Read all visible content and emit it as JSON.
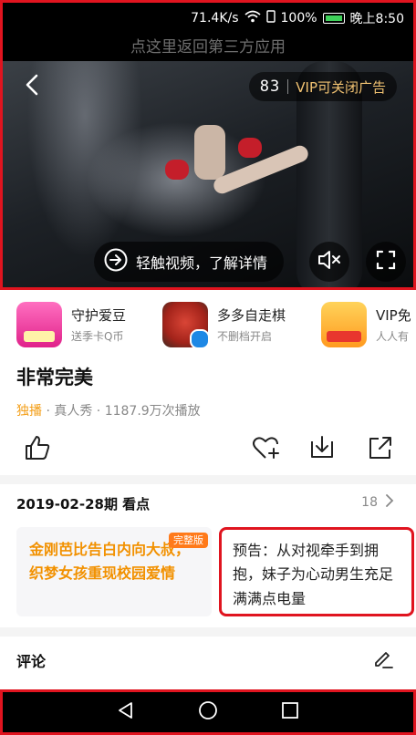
{
  "status": {
    "speed": "71.4K/s",
    "battery": "100%",
    "time": "晚上8:50"
  },
  "video": {
    "back_to_app": "点这里返回第三方应用",
    "countdown": "83",
    "vip_close_ad": "VIP可关闭广告",
    "tap_learn_more": "轻触视频，了解详情"
  },
  "ads": [
    {
      "title": "守护爱豆",
      "subtitle": "送季卡Q币"
    },
    {
      "title": "多多自走棋",
      "subtitle": "不删档开启"
    },
    {
      "title": "VIP免",
      "subtitle": "人人有"
    }
  ],
  "show": {
    "title": "非常完美",
    "exclusive": "独播",
    "meta_rest": " · 真人秀 · 1187.9万次播放"
  },
  "episodes": {
    "heading": "2019-02-28期 看点",
    "count": "18",
    "cards": [
      {
        "text": "金刚芭比告白内向大叔，织梦女孩重现校园爱情",
        "badge": "完整版"
      },
      {
        "text": "预告：从对视牵手到拥抱，妹子为心动男生充足满满点电量"
      }
    ]
  },
  "comments": {
    "title": "评论"
  },
  "colors": {
    "accent_red": "#e0141f",
    "orange": "#f29100",
    "vip_gold": "#f2c372"
  }
}
